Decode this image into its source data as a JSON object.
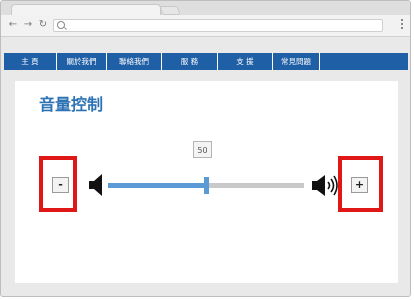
{
  "browser": {
    "address_bar_value": ""
  },
  "icons": {
    "back": "arrow-left-icon",
    "forward": "arrow-right-icon",
    "reload": "reload-icon",
    "search": "search-icon",
    "menu": "menu-dots-icon",
    "mute": "speaker-icon",
    "loud": "speaker-waves-icon"
  },
  "nav": {
    "items": [
      {
        "label": "主 頁"
      },
      {
        "label": "關於我們"
      },
      {
        "label": "聯絡我們"
      },
      {
        "label": "服 務"
      },
      {
        "label": "支 援"
      },
      {
        "label": "常見問題"
      }
    ]
  },
  "page": {
    "title": "音量控制"
  },
  "volume": {
    "display": "50",
    "level": 0.5,
    "decrease_label": "-",
    "increase_label": "+"
  },
  "colors": {
    "nav_bg": "#1f5fa5",
    "title": "#2e74b5",
    "slider_fill": "#5b9bd5",
    "slider_track": "#c9c9c9",
    "highlight": "#e01717"
  }
}
